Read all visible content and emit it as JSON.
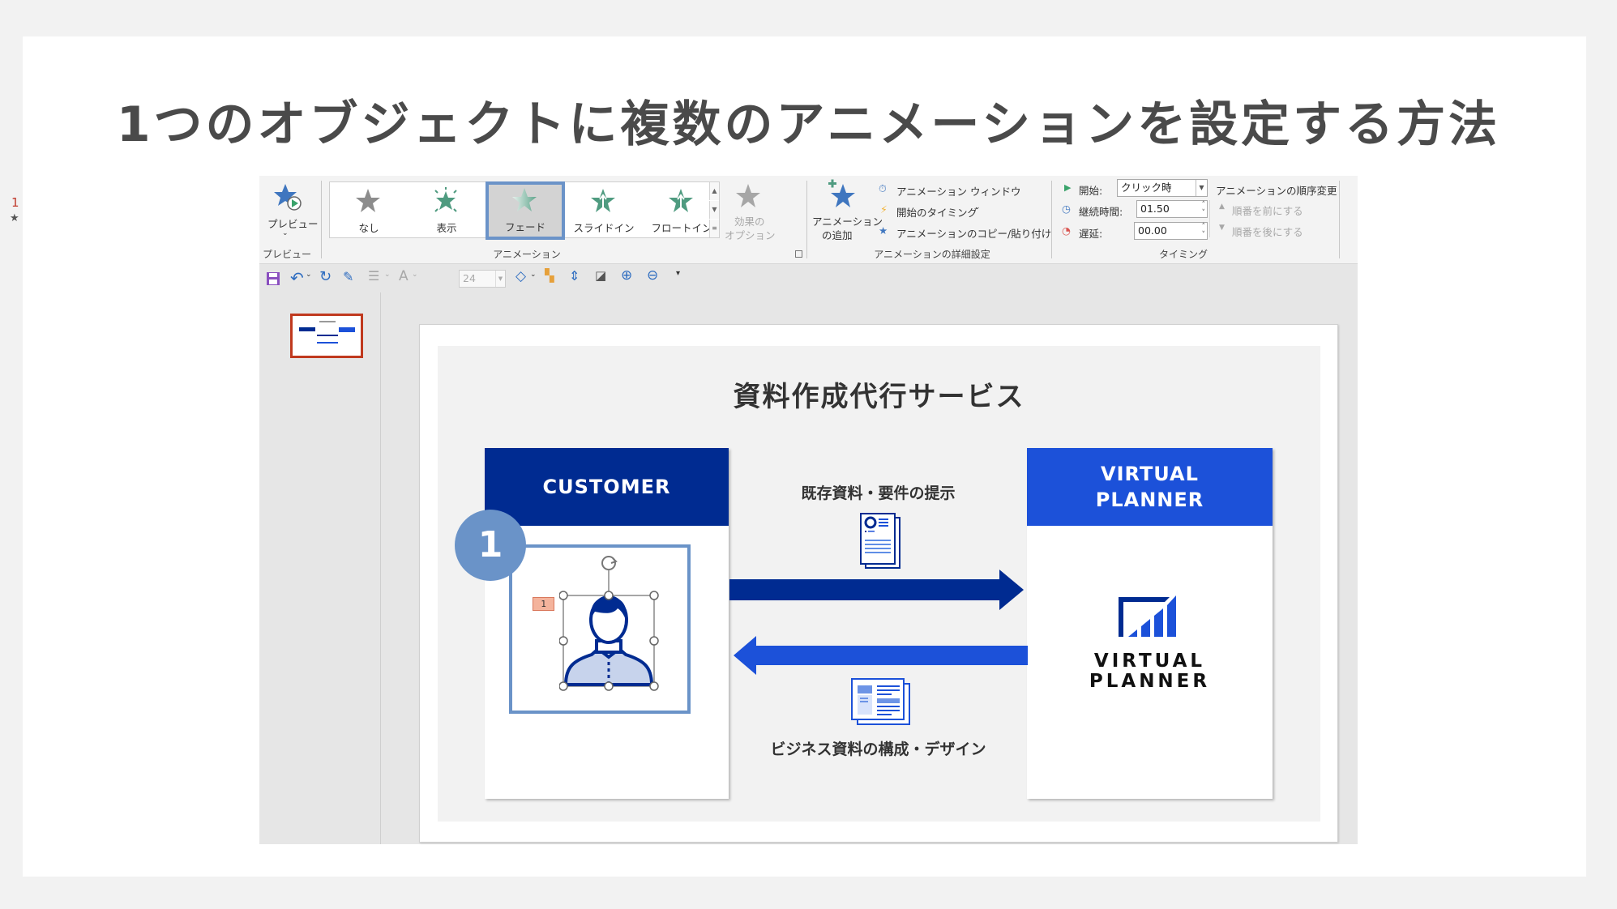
{
  "page": {
    "title": "1つのオブジェクトに複数のアニメーションを設定する方法"
  },
  "ribbon": {
    "preview": {
      "button_label": "プレビュー",
      "group_label": "プレビュー"
    },
    "animation_gallery": {
      "group_label": "アニメーション",
      "items": [
        {
          "label": "なし",
          "icon": "star-none-icon",
          "selected": false
        },
        {
          "label": "表示",
          "icon": "star-appear-icon",
          "selected": false
        },
        {
          "label": "フェード",
          "icon": "star-fade-icon",
          "selected": true
        },
        {
          "label": "スライドイン",
          "icon": "star-fly-in-icon",
          "selected": false
        },
        {
          "label": "フロートイン",
          "icon": "star-float-in-icon",
          "selected": false
        }
      ],
      "effect_options_line1": "効果の",
      "effect_options_line2": "オプション"
    },
    "advanced": {
      "group_label": "アニメーションの詳細設定",
      "add_animation_line1": "アニメーション",
      "add_animation_line2": "の追加",
      "animation_pane": "アニメーション ウィンドウ",
      "trigger": "開始のタイミング",
      "animation_painter": "アニメーションのコピー/貼り付け"
    },
    "timing": {
      "group_label": "タイミング",
      "start_label": "開始:",
      "start_value": "クリック時",
      "duration_label": "継続時間:",
      "duration_value": "01.50",
      "delay_label": "遅延:",
      "delay_value": "00.00",
      "reorder_title": "アニメーションの順序変更",
      "move_earlier": "順番を前にする",
      "move_later": "順番を後にする"
    }
  },
  "qat": {
    "font_size_value": "24",
    "icons": [
      "save-icon",
      "undo-icon",
      "redo-icon",
      "format-painter-icon",
      "bullets-icon",
      "font-color-icon",
      "font-size-box",
      "shapes-icon",
      "arrange-icon",
      "line-spacing-icon",
      "edit-shape-icon",
      "zoom-in-icon",
      "zoom-out-icon",
      "customize-qat-icon"
    ]
  },
  "thumbnails": {
    "slide_number": "1",
    "has_animation_marker": "★"
  },
  "slide": {
    "title": "資料作成代行サービス",
    "customer_header": "CUSTOMER",
    "vp_header_line1": "VIRTUAL",
    "vp_header_line2": "PLANNER",
    "caption_top": "既存資料・要件の提示",
    "caption_bottom": "ビジネス資料の構成・デザイン",
    "step_badge": "1",
    "animation_tag": "1",
    "vp_logo_line1": "VIRTUAL",
    "vp_logo_line2": "PLANNER"
  },
  "colors": {
    "customer_blue": "#002b91",
    "vp_blue": "#1c51d9",
    "highlight_blue": "#6a93c8",
    "animation_green": "#5a9e86",
    "tag_orange": "#f4b39c"
  }
}
